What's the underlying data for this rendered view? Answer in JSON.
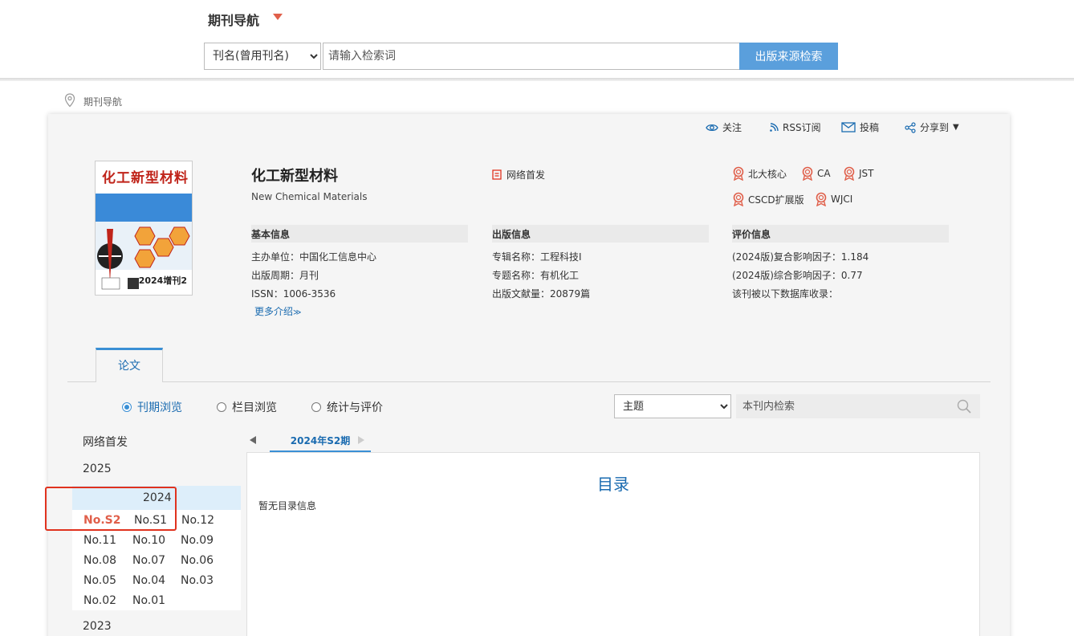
{
  "header": {
    "nav_title": "期刊导航",
    "search_field_selected": "刊名(曾用刊名)",
    "search_placeholder": "请输入检索词",
    "search_button": "出版来源检索"
  },
  "breadcrumb": "期刊导航",
  "toolbar": {
    "follow": "关注",
    "rss": "RSS订阅",
    "submit": "投稿",
    "share": "分享到"
  },
  "journal": {
    "title_cn": "化工新型材料",
    "title_en": "New Chemical Materials",
    "online_first": "网络首发",
    "cover_title": "化工新型材料",
    "cover_year": "2024增刊2",
    "badges": [
      "北大核心",
      "CA",
      "JST",
      "CSCD扩展版",
      "WJCI"
    ]
  },
  "basic_info": {
    "heading": "基本信息",
    "sponsor": "主办单位：中国化工信息中心",
    "period": "出版周期：月刊",
    "issn": "ISSN：1006-3536",
    "more": "更多介绍"
  },
  "publish_info": {
    "heading": "出版信息",
    "special_name": "专辑名称：工程科技I",
    "topic_name": "专题名称：有机化工",
    "count": "出版文献量：20879篇"
  },
  "eval_info": {
    "heading": "评价信息",
    "composite_if": "(2024版)复合影响因子：1.184",
    "comprehensive_if": "(2024版)综合影响因子：0.77",
    "db_label": "该刊被以下数据库收录："
  },
  "tabs": {
    "papers": "论文"
  },
  "browse_modes": [
    "刊期浏览",
    "栏目浏览",
    "统计与评价"
  ],
  "inner_search": {
    "scope_selected": "主题",
    "placeholder": "本刊内检索"
  },
  "year_list": {
    "online_first": "网络首发",
    "y2025": "2025",
    "y2024": "2024",
    "y2023": "2023",
    "issues_2024": [
      [
        "No.S2",
        "No.S1",
        "No.12"
      ],
      [
        "No.11",
        "No.10",
        "No.09"
      ],
      [
        "No.08",
        "No.07",
        "No.06"
      ],
      [
        "No.05",
        "No.04",
        "No.03"
      ],
      [
        "No.02",
        "No.01",
        ""
      ]
    ]
  },
  "contents": {
    "current_issue": "2024年S2期",
    "title": "目录",
    "empty_message": "暂无目录信息"
  }
}
